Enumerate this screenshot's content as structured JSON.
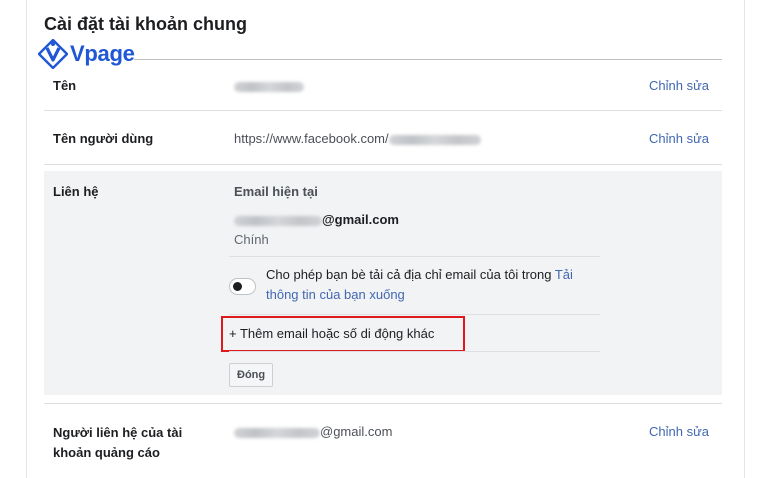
{
  "header": {
    "title": "Cài đặt tài khoản chung",
    "logo_text": "Vpage"
  },
  "rows": {
    "name": {
      "label": "Tên",
      "edit": "Chỉnh sửa"
    },
    "username": {
      "label": "Tên người dùng",
      "value_prefix": "https://www.facebook.com/",
      "edit": "Chỉnh sửa"
    },
    "contact": {
      "label": "Liên hệ",
      "current_email_heading": "Email hiện tại",
      "email_suffix": "@gmail.com",
      "email_status": "Chính",
      "toggle_text": "Cho phép bạn bè tải cả địa chỉ email của tôi trong ",
      "toggle_link": "Tải thông tin của bạn xuống",
      "add_contact": "+ Thêm email hoặc số di động khác",
      "close_button": "Đóng"
    },
    "ad_contact": {
      "label": "Người liên hệ của tài khoản quảng cáo",
      "email_suffix": "@gmail.com",
      "edit": "Chỉnh sửa"
    }
  },
  "colors": {
    "link": "#4267b2",
    "highlight": "#e0191f",
    "logo": "#1f57d6",
    "expanded_bg": "#f2f3f5"
  },
  "icons": {
    "logo": "vpage-logo-icon",
    "toggle": "toggle-switch-off"
  }
}
